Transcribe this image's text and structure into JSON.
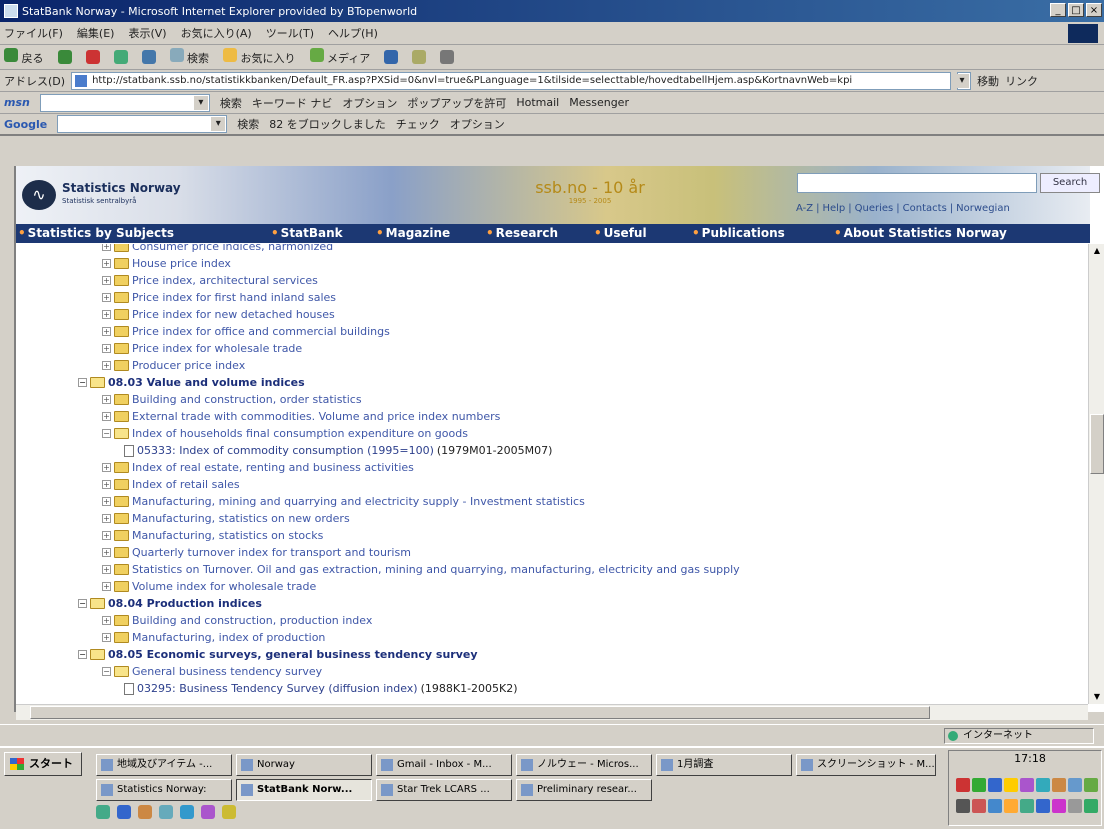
{
  "window": {
    "title": "StatBank Norway - Microsoft Internet Explorer provided by BTopenworld",
    "controls": [
      "_",
      "□",
      "×"
    ]
  },
  "menubar": {
    "items": [
      "ファイル(F)",
      "編集(E)",
      "表示(V)",
      "お気に入り(A)",
      "ツール(T)",
      "ヘルプ(H)"
    ]
  },
  "toolbar": {
    "back": "戻る",
    "search": "検索",
    "favorites": "お気に入り",
    "media": "メディア"
  },
  "address": {
    "label": "アドレス(D)",
    "url": "http://statbank.ssb.no/statistikkbanken/Default_FR.asp?PXSid=0&nvl=true&PLanguage=1&tilside=selecttable/hovedtabellHjem.asp&KortnavnWeb=kpi",
    "go": "移動",
    "links": "リンク"
  },
  "msnbar": {
    "logo": "msn",
    "search": "検索",
    "highlight": "キーワード ナビ",
    "options": "オプション",
    "popup": "ポップアップを許可",
    "hotmail": "Hotmail",
    "messenger": "Messenger"
  },
  "googlebar": {
    "logo": "Google",
    "search": "検索",
    "blocked": "82 をブロックしました",
    "check": "チェック",
    "options": "オプション"
  },
  "site": {
    "logo_title": "Statistics Norway",
    "logo_sub": "Statistisk sentralbyrå",
    "banner": "ssb.no - 10 år",
    "banner_years": "1995 - 2005",
    "search_button": "Search",
    "toplinks": [
      "A-Z",
      "|",
      "Help",
      "|",
      "Queries",
      "|",
      "Contacts",
      "|",
      "Norwegian"
    ],
    "nav": [
      "Statistics by Subjects",
      "StatBank",
      "Magazine",
      "Research",
      "Useful",
      "Publications",
      "About Statistics Norway"
    ]
  },
  "tree": [
    {
      "label": "Consumer price indices, harmonized",
      "type": "folder"
    },
    {
      "label": "House price index",
      "type": "folder"
    },
    {
      "label": "Price index, architectural services",
      "type": "folder"
    },
    {
      "label": "Price index for first hand inland sales",
      "type": "folder"
    },
    {
      "label": "Price index for new detached houses",
      "type": "folder"
    },
    {
      "label": "Price index for office and commercial buildings",
      "type": "folder"
    },
    {
      "label": "Price index for wholesale trade",
      "type": "folder"
    },
    {
      "label": "Producer price index",
      "type": "folder"
    },
    {
      "label": "08.03 Value and volume indices",
      "type": "section"
    },
    {
      "label": "Building and construction, order statistics",
      "type": "folder"
    },
    {
      "label": "External trade with commodities. Volume and price index numbers",
      "type": "folder"
    },
    {
      "label": "Index of households final consumption expenditure on goods",
      "type": "openfolder"
    },
    {
      "label": "05333: Index of commodity consumption (1995=100)",
      "period": "(1979M01-2005M07)",
      "type": "table"
    },
    {
      "label": "Index of real estate, renting and business activities",
      "type": "folder"
    },
    {
      "label": "Index of retail sales",
      "type": "folder"
    },
    {
      "label": "Manufacturing, mining and quarrying and electricity supply - Investment statistics",
      "type": "folder"
    },
    {
      "label": "Manufacturing, statistics on new orders",
      "type": "folder"
    },
    {
      "label": "Manufacturing, statistics on stocks",
      "type": "folder"
    },
    {
      "label": "Quarterly turnover index for transport and tourism",
      "type": "folder"
    },
    {
      "label": "Statistics on Turnover. Oil and gas extraction, mining and quarrying, manufacturing, electricity and gas supply",
      "type": "folder"
    },
    {
      "label": "Volume index for wholesale trade",
      "type": "folder"
    },
    {
      "label": "08.04 Production indices",
      "type": "section"
    },
    {
      "label": "Building and construction, production index",
      "type": "folder"
    },
    {
      "label": "Manufacturing, index of production",
      "type": "folder"
    },
    {
      "label": "08.05 Economic surveys, general business tendency survey",
      "type": "section"
    },
    {
      "label": "General business tendency survey",
      "type": "openfolder"
    },
    {
      "label": "03295: Business Tendency Survey (diffusion index)",
      "period": "(1988K1-2005K2)",
      "type": "table"
    }
  ],
  "status": {
    "zone": "インターネット"
  },
  "taskbar": {
    "start": "スタート",
    "tasks_row1": [
      "地域及びアイテム -...",
      "Norway",
      "Gmail - Inbox - M...",
      "ノルウェー - Micros...",
      "1月調査",
      "スクリーンショット - M..."
    ],
    "tasks_row2": [
      "Statistics Norway:",
      "StatBank Norw...",
      "Star Trek LCARS ...",
      "Preliminary resear..."
    ],
    "clock": "17:18"
  }
}
